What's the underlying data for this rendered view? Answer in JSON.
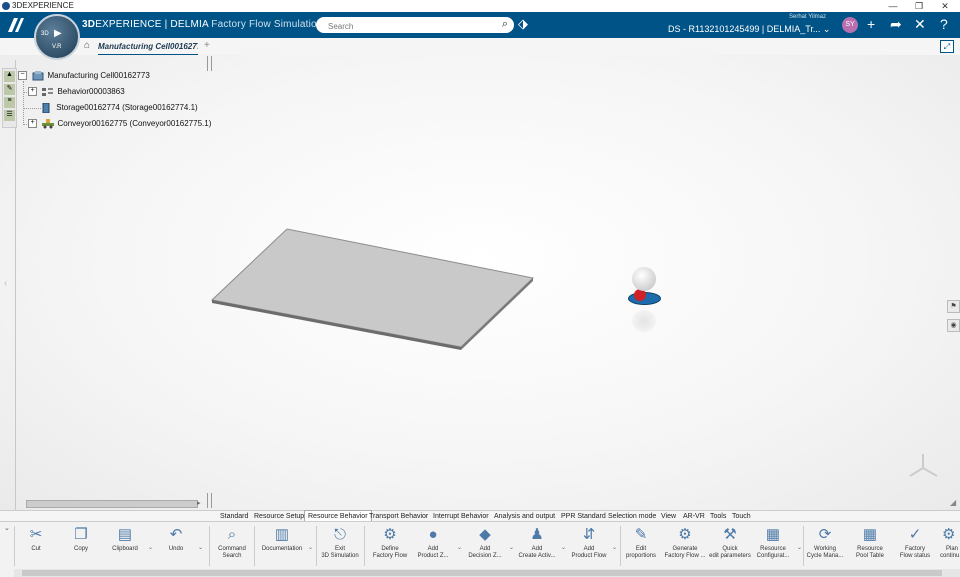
{
  "window": {
    "app_title": "3DEXPERIENCE",
    "buttons": [
      "—",
      "❐",
      "✕"
    ]
  },
  "topbar": {
    "ds_logo": "3DS",
    "compass": {
      "label_left": "3D",
      "label_play": "▶",
      "label_bottom": "V.R"
    },
    "brand_3d": "3D",
    "brand_exp": "EXPERIENCE | DELMIA",
    "app_name": "Factory Flow Simulation",
    "search_placeholder": "Search",
    "user_name": "Serhat Yilmaz",
    "context": "DS - R1132101245499 | DELMIA_Tr... ⌄",
    "avatar_initials": "SY",
    "icons": [
      "plus-icon",
      "share-icon",
      "tools-icon",
      "help-icon"
    ]
  },
  "tabbar": {
    "active_tab": "Manufacturing Cell00162773"
  },
  "tree": {
    "root": "Manufacturing Cell00162773",
    "children": [
      {
        "label": "Behavior00003863",
        "expandable": true
      },
      {
        "label": "Storage00162774 (Storage00162774.1)",
        "expandable": false
      },
      {
        "label": "Conveyor00162775 (Conveyor00162775.1)",
        "expandable": true
      }
    ]
  },
  "toolbar_tabs": [
    "Standard",
    "Resource Setup",
    "Resource Behavior",
    "Transport Behavior",
    "Interrupt Behavior",
    "Analysis and output",
    "PPR Standard",
    "Selection mode",
    "View",
    "AR-VR",
    "Tools",
    "Touch"
  ],
  "actions": [
    {
      "line1": "Cut",
      "line2": "",
      "icon": "scissors-icon",
      "glyph": "✂"
    },
    {
      "line1": "Copy",
      "line2": "",
      "icon": "copy-icon",
      "glyph": "❐"
    },
    {
      "line1": "Clipboard",
      "line2": "",
      "icon": "clipboard-icon",
      "glyph": "▤"
    },
    {
      "line1": "Undo",
      "line2": "",
      "icon": "undo-icon",
      "glyph": "↶"
    },
    {
      "line1": "Command",
      "line2": "Search",
      "icon": "command-search-icon",
      "glyph": "⌕"
    },
    {
      "line1": "Documentation",
      "line2": "",
      "icon": "documentation-icon",
      "glyph": "▥"
    },
    {
      "line1": "Exit",
      "line2": "3D Simulation",
      "icon": "exit-simulation-icon",
      "glyph": "⎋"
    },
    {
      "line1": "Define",
      "line2": "Factory Flow",
      "icon": "define-factory-flow-icon",
      "glyph": "⚙"
    },
    {
      "line1": "Add",
      "line2": "Product Z...",
      "icon": "add-product-zone-icon",
      "glyph": "●"
    },
    {
      "line1": "Add",
      "line2": "Decision Z...",
      "icon": "add-decision-zone-icon",
      "glyph": "◆"
    },
    {
      "line1": "Add",
      "line2": "Create Activ...",
      "icon": "add-create-activity-icon",
      "glyph": "♟"
    },
    {
      "line1": "Add",
      "line2": "Product Flow",
      "icon": "add-product-flow-icon",
      "glyph": "⇵"
    },
    {
      "line1": "Edit",
      "line2": "proportions",
      "icon": "edit-proportions-icon",
      "glyph": "✎"
    },
    {
      "line1": "Generate",
      "line2": "Factory Flow ...",
      "icon": "generate-factory-flow-icon",
      "glyph": "⚙"
    },
    {
      "line1": "Quick",
      "line2": "edit parameters",
      "icon": "quick-edit-icon",
      "glyph": "⚒"
    },
    {
      "line1": "Resource",
      "line2": "Configurat...",
      "icon": "resource-config-icon",
      "glyph": "▦"
    },
    {
      "line1": "Working",
      "line2": "Cycle Mana...",
      "icon": "working-cycle-icon",
      "glyph": "⟳"
    },
    {
      "line1": "Resource",
      "line2": "Pool Table",
      "icon": "resource-pool-icon",
      "glyph": "▦"
    },
    {
      "line1": "Factory",
      "line2": "Flow status",
      "icon": "factory-flow-status-icon",
      "glyph": "✓"
    },
    {
      "line1": "Plan",
      "line2": "continu...",
      "icon": "plan-continuous-icon",
      "glyph": "⚙"
    }
  ],
  "colors": {
    "topbar": "#005386",
    "plate": "#c8c8c8",
    "accent": "#4d7aa8"
  }
}
